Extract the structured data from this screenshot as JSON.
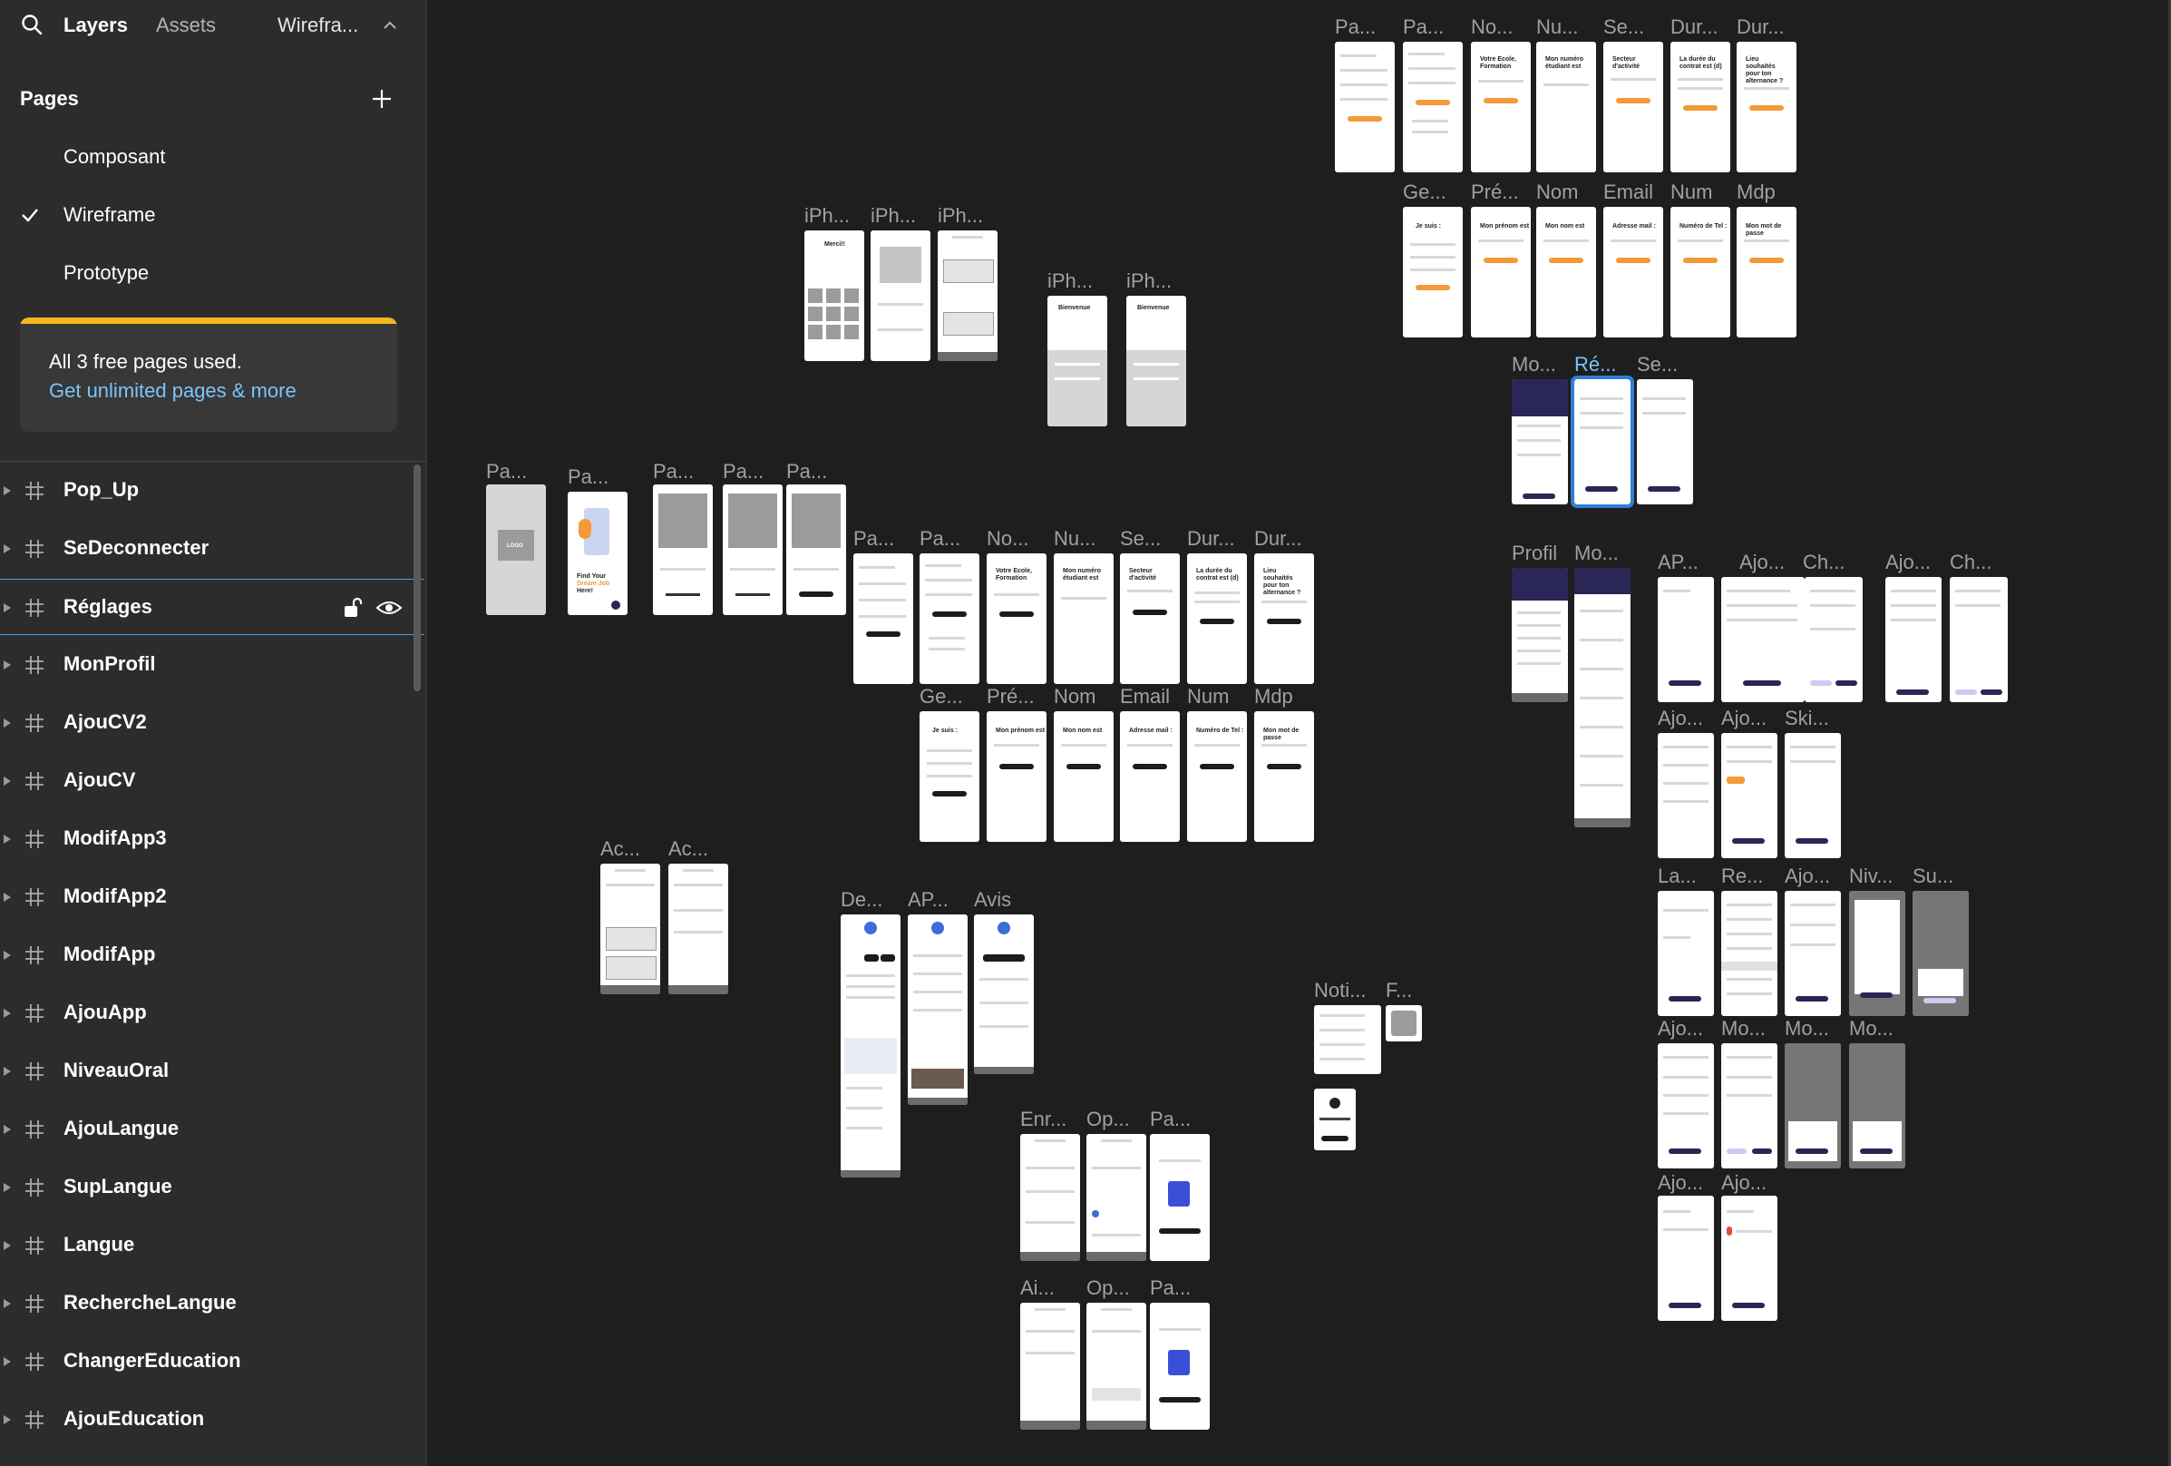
{
  "sidebar": {
    "tabs": {
      "layers": "Layers",
      "assets": "Assets",
      "file": "Wirefra..."
    },
    "pages_header": "Pages",
    "pages": [
      {
        "label": "Composant",
        "selected": false
      },
      {
        "label": "Wireframe",
        "selected": true
      },
      {
        "label": "Prototype",
        "selected": false
      }
    ],
    "banner": {
      "line1": "All 3 free pages used.",
      "line2": "Get unlimited pages & more"
    },
    "layers": [
      "Pop_Up",
      "SeDeconnecter",
      "Réglages",
      "MonProfil",
      "AjouCV2",
      "AjouCV",
      "ModifApp3",
      "ModifApp2",
      "ModifApp",
      "AjouApp",
      "NiveauOral",
      "AjouLangue",
      "SupLangue",
      "Langue",
      "RechercheLangue",
      "ChangerEducation",
      "AjouEducation"
    ],
    "selected_layer": "Réglages",
    "icons": [
      "search-icon",
      "chevron-up-icon",
      "plus-icon",
      "check-icon",
      "frame-hash-icon",
      "caret-right-icon",
      "unlock-icon",
      "eye-icon"
    ],
    "accent_colors": {
      "banner_stripe": "#f5b91d",
      "link": "#7cc4fa",
      "selection": "#2e7fd8"
    }
  },
  "canvas": {
    "frame_labels": {
      "tr1": [
        "Pa...",
        "Pa...",
        "No...",
        "Nu...",
        "Se...",
        "Dur...",
        "Dur..."
      ],
      "tr2": [
        "Ge...",
        "Pré...",
        "Nom",
        "Email",
        "Num",
        "Mdp"
      ],
      "iph": [
        "iPh...",
        "iPh...",
        "iPh..."
      ],
      "iph2": [
        "iPh...",
        "iPh..."
      ],
      "mo": [
        "Mo...",
        "Ré...",
        "Se..."
      ],
      "pa5": [
        "Pa...",
        "Pa...",
        "Pa...",
        "Pa...",
        "Pa..."
      ],
      "mid1": [
        "Pa...",
        "Pa...",
        "No...",
        "Nu...",
        "Se...",
        "Dur...",
        "Dur..."
      ],
      "mid2": [
        "Ge...",
        "Pré...",
        "Nom",
        "Email",
        "Num",
        "Mdp"
      ],
      "profil": [
        "Profil",
        "Mo..."
      ],
      "ap": [
        "AP...",
        "Ajo...",
        "Ch...",
        "Ajo...",
        "Ch..."
      ],
      "aj": [
        "Ajo...",
        "Ajo...",
        "Ski..."
      ],
      "la": [
        "La...",
        "Re...",
        "Ajo...",
        "Niv...",
        "Su..."
      ],
      "aj2": [
        "Ajo...",
        "Mo...",
        "Mo...",
        "Mo..."
      ],
      "aj3": [
        "Ajo...",
        "Ajo..."
      ],
      "ac": [
        "Ac...",
        "Ac..."
      ],
      "de": [
        "De...",
        "AP...",
        "Avis"
      ],
      "noti": [
        "Noti...",
        "F..."
      ],
      "en": [
        "Enr...",
        "Op...",
        "Pa..."
      ],
      "ai": [
        "Ai...",
        "Op...",
        "Pa..."
      ]
    },
    "frame_texts": {
      "find_your": "Find Your",
      "dream_job": "Dream Job",
      "here": "Here!",
      "logo": "LOGO",
      "merci": "Merci!!",
      "bienvenue": "Bienvenue",
      "votre_ecole": "Votre Ecole, Formation",
      "mon_numero": "Mon numéro étudiant est",
      "secteur": "Secteur d'activité",
      "duree": "La durée du contrat est (d)",
      "lieu": "Lieu souhaités pour ton alternance ?",
      "je_suis": "Je suis :",
      "prenom": "Mon prénom est",
      "nom": "Mon nom est",
      "email": "Adresse mail :",
      "num": "Numéro de Tel :",
      "mdp": "Mon mot de passe"
    }
  }
}
